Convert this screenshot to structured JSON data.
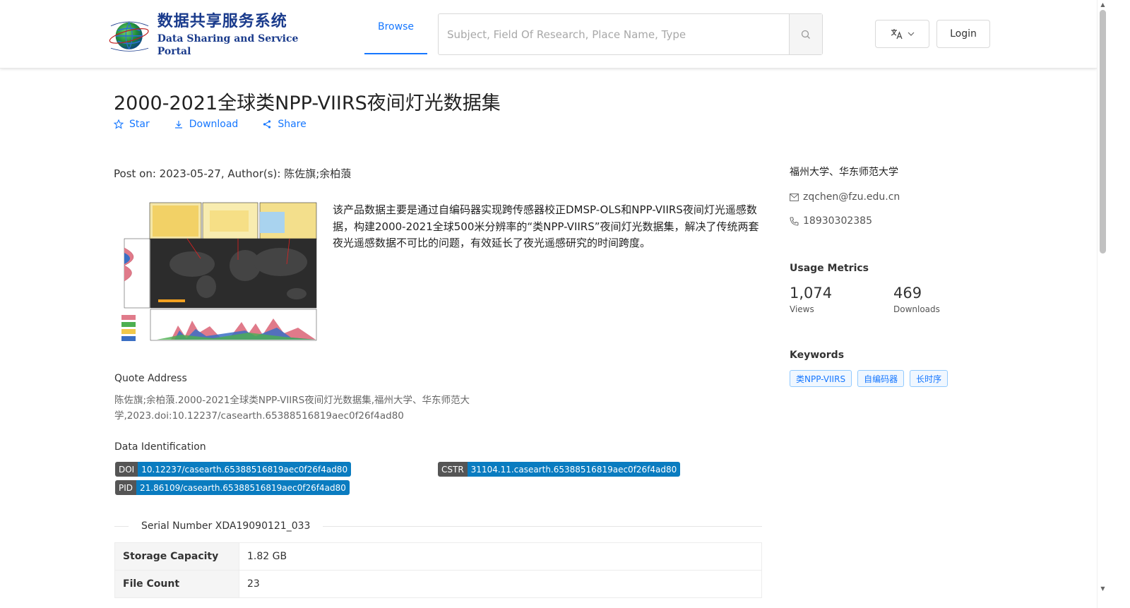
{
  "header": {
    "logo_cn": "数据共享服务系统",
    "logo_en": "Data Sharing and Service Portal",
    "nav_browse": "Browse",
    "search_placeholder": "Subject, Field Of Research, Place Name, Type",
    "login_label": "Login"
  },
  "dataset": {
    "title": "2000-2021全球类NPP-VIIRS夜间灯光数据集",
    "actions": {
      "star": "Star",
      "download": "Download",
      "share": "Share"
    },
    "post_on": "Post on: 2023-05-27, Author(s): 陈佐旗;余柏蒗",
    "description": "该产品数据主要是通过自编码器实现跨传感器校正DMSP-OLS和NPP-VIIRS夜间灯光遥感数据，构建2000-2021全球500米分辨率的“类NPP-VIIRS”夜间灯光数据集，解决了传统两套夜光遥感数据不可比的问题，有效延长了夜光遥感研究的时间跨度。",
    "quote_label": "Quote Address",
    "quote_text": "陈佐旗;余柏蒗.2000-2021全球类NPP-VIIRS夜间灯光数据集,福州大学、华东师范大学,2023.doi:10.12237/casearth.65388516819aec0f26f4ad80",
    "identification_label": "Data Identification",
    "identifiers": {
      "doi_key": "DOI",
      "doi_value": "10.12237/casearth.65388516819aec0f26f4ad80",
      "cstr_key": "CSTR",
      "cstr_value": "31104.11.casearth.65388516819aec0f26f4ad80",
      "pid_key": "PID",
      "pid_value": "21.86109/casearth.65388516819aec0f26f4ad80"
    },
    "serial_number": "Serial Number XDA19090121_033",
    "specs": [
      {
        "key": "Storage Capacity",
        "value": "1.82 GB"
      },
      {
        "key": "File Count",
        "value": "23"
      }
    ]
  },
  "sidebar": {
    "organization": "福州大学、华东师范大学",
    "email": "zqchen@fzu.edu.cn",
    "phone": "18930302385",
    "metrics_title": "Usage Metrics",
    "views_value": "1,074",
    "views_label": "Views",
    "downloads_value": "469",
    "downloads_label": "Downloads",
    "keywords_title": "Keywords",
    "keywords": [
      "类NPP-VIIRS",
      "自编码器",
      "长时序"
    ]
  },
  "colors": {
    "accent": "#1677ff",
    "badge_value_bg": "#0a7cc0",
    "badge_key_bg": "#555555"
  },
  "icons": {
    "star": "star-icon",
    "download": "download-icon",
    "share": "share-icon",
    "search": "search-icon",
    "translate": "translate-icon",
    "mail": "mail-icon",
    "phone": "phone-icon"
  }
}
